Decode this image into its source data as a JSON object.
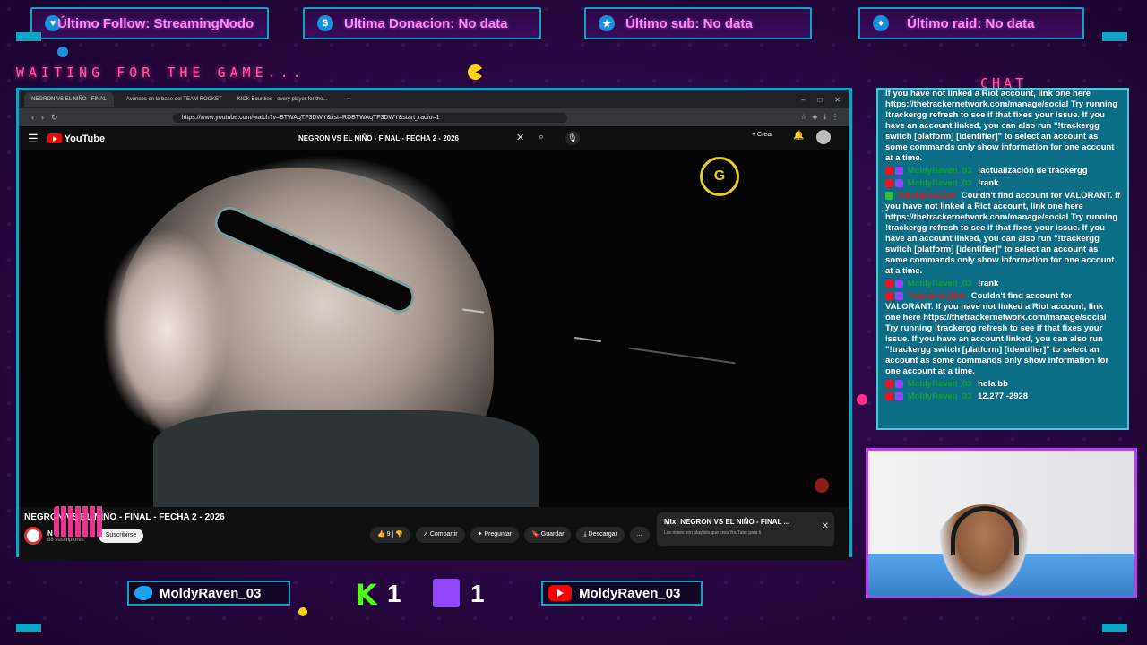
{
  "top_bars": {
    "follow": {
      "icon": "heart-icon",
      "text": "Último Follow: StreamingNodo"
    },
    "donation": {
      "icon": "dollar-icon",
      "text": "Ultima Donacion: No data"
    },
    "sub": {
      "icon": "star-icon",
      "text": "Último sub: No data"
    },
    "raid": {
      "icon": "diamond-icon",
      "text": "Último raid: No data"
    }
  },
  "overlay": {
    "waiting_text": "WAITING FOR THE GAME...",
    "chat_title": "CHAT"
  },
  "browser": {
    "tabs": [
      {
        "label": "NEGRON VS EL NIÑO - FINAL",
        "active": true
      },
      {
        "label": "Avances en la base del TEAM ROCKET",
        "active": false
      },
      {
        "label": "KICK Bounties - every player for the...",
        "active": false
      }
    ],
    "new_tab": "+",
    "url": "https://www.youtube.com/watch?v=BTWAqTF3DWY&list=RDBTWAqTF3DWY&start_radio=1"
  },
  "youtube": {
    "logo_text": "YouTube",
    "search_query": "NEGRON VS EL NIÑO - FINAL - FECHA 2 - 2026",
    "create_label": "Crear",
    "video_title": "NEGRON VS EL NIÑO - FINAL - FECHA 2 - 2026",
    "channel_name": "N",
    "subscribers": "88 suscriptores",
    "subscribe_label": "Suscribirse",
    "like_count": "9",
    "actions": {
      "share": "Compartir",
      "ask": "Preguntar",
      "save": "Guardar",
      "download": "Descargar",
      "more": "..."
    },
    "mix": {
      "title": "Mix: NEGRON VS EL NIÑO - FINAL ...",
      "subtitle": "Los mixes son playlists que crea YouTube para ti"
    }
  },
  "chat": [
    {
      "user": "",
      "text": "If you have not linked a Riot account, link one here https://thetrackernetwork.com/manage/social Try running !trackergg refresh to see if that fixes your issue. If you have an account linked, you can also run \"!trackergg switch [platform] [identifier]\" to select an account as some commands only show information for one account at a time.",
      "badges": []
    },
    {
      "user": "MoldyRaven_03",
      "text": "!actualización de trackergg",
      "badges": [
        "red",
        "purple"
      ],
      "color": "green"
    },
    {
      "user": "MoldyRaven_03",
      "text": "!rank",
      "badges": [
        "red",
        "purple"
      ],
      "color": "green"
    },
    {
      "user": "TrackerGGBot",
      "text": "Couldn't find account for VALORANT. If you have not linked a Riot account, link one here https://thetrackernetwork.com/manage/social Try running !trackergg refresh to see if that fixes your issue. If you have an account linked, you can also run \"!trackergg switch [platform] [identifier]\" to select an account as some commands only show information for one account at a time.",
      "badges": [
        "green"
      ],
      "color": "red"
    },
    {
      "user": "MoldyRaven_03",
      "text": "!rank",
      "badges": [
        "red",
        "purple"
      ],
      "color": "green"
    },
    {
      "user": "TrackerGGBot",
      "text": "Couldn't find account for VALORANT. If you have not linked a Riot account, link one here https://thetrackernetwork.com/manage/social Try running !trackergg refresh to see if that fixes your issue. If you have an account linked, you can also run \"!trackergg switch [platform] [identifier]\" to select an account as some commands only show information for one account at a time.",
      "badges": [
        "red",
        "purple"
      ],
      "color": "red"
    },
    {
      "user": "MoldyRaven_03",
      "text": "hola bb",
      "badges": [
        "red",
        "purple"
      ],
      "color": "green"
    },
    {
      "user": "MoldyRaven_03",
      "text": "12.277 -2928",
      "badges": [
        "red",
        "purple"
      ],
      "color": "green"
    }
  ],
  "socials": {
    "twitter": "MoldyRaven_03",
    "youtube": "MoldyRaven_03",
    "kick_count": "1",
    "twitch_count": "1"
  },
  "colors": {
    "frame": "#0fa3c4",
    "accent_pink": "#ff5aa8",
    "chat_bg": "#0c6d86",
    "webcam_border": "#b245e0"
  }
}
